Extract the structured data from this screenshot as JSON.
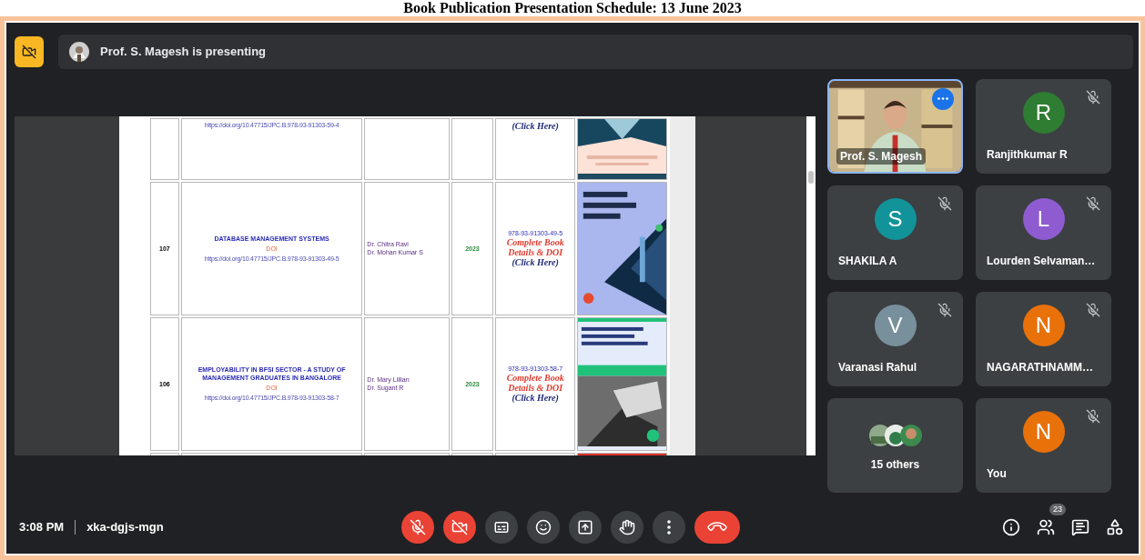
{
  "document_title": "Book Publication Presentation Schedule: 13 June 2023",
  "top_bar": {
    "presenting_label": "Prof. S. Magesh is presenting"
  },
  "table": {
    "rows": [
      {
        "number": "",
        "title": "",
        "doi_label": "",
        "url": "https://doi.org/10.47715/JPC.B.978-93-91303-59-4",
        "authors": [],
        "year": "",
        "isbn": "",
        "details_link": "",
        "click_here": "(Click Here)"
      },
      {
        "number": "107",
        "title": "DATABASE MANAGEMENT SYSTEMS",
        "doi_label": "DOI",
        "url": "https://doi.org/10.47715/JPC.B.978-93-91303-49-5",
        "authors": [
          "Dr. Chitra Ravi",
          "Dr. Mohan Kumar S"
        ],
        "year": "2023",
        "isbn": "978-93-91303-49-5",
        "details_link": "Complete Book Details & DOI",
        "click_here": "(Click Here)"
      },
      {
        "number": "106",
        "title": "EMPLOYABILITY IN BFSI SECTOR - A STUDY OF MANAGEMENT GRADUATES IN BANGALORE",
        "doi_label": "DOI",
        "url": "https://doi.org/10.47715/JPC.B.978-93-91303-58-7",
        "authors": [
          "Dr. Mary Lillian",
          "Dr. Sugant R"
        ],
        "year": "2023",
        "isbn": "978-93-91303-58-7",
        "details_link": "Complete Book Details & DOI",
        "click_here": "(Click Here)"
      }
    ]
  },
  "participants": [
    {
      "kind": "video",
      "name": "Prof. S. Magesh",
      "highlighted": true,
      "muted": false
    },
    {
      "kind": "avatar",
      "letter": "R",
      "color": "#2e7d32",
      "name": "Ranjithkumar R",
      "muted": true
    },
    {
      "kind": "avatar",
      "letter": "S",
      "color": "#12939a",
      "name": "SHAKILA A",
      "muted": true
    },
    {
      "kind": "avatar",
      "letter": "L",
      "color": "#8e5bd0",
      "name": "Lourden Selvaman…",
      "muted": true
    },
    {
      "kind": "avatar",
      "letter": "V",
      "color": "#78909c",
      "name": "Varanasi Rahul",
      "muted": true
    },
    {
      "kind": "avatar",
      "letter": "N",
      "color": "#e8710a",
      "name": "NAGARATHNAMM…",
      "muted": true
    },
    {
      "kind": "others",
      "name": "15 others",
      "muted": false
    },
    {
      "kind": "avatar",
      "letter": "N",
      "color": "#e8710a",
      "name": "You",
      "muted": true
    }
  ],
  "bottom_bar": {
    "time": "3:08 PM",
    "meeting_code": "xka-dgjs-mgn",
    "controls": [
      {
        "kind": "mic",
        "on": false
      },
      {
        "kind": "camera",
        "on": false
      },
      {
        "kind": "captions",
        "on": false
      },
      {
        "kind": "emoji",
        "on": false
      },
      {
        "kind": "present",
        "on": false
      },
      {
        "kind": "hand",
        "on": false
      },
      {
        "kind": "more"
      },
      {
        "kind": "end"
      }
    ],
    "side_buttons": [
      {
        "kind": "info"
      },
      {
        "kind": "people",
        "badge": "23"
      },
      {
        "kind": "chat"
      },
      {
        "kind": "activities"
      }
    ]
  }
}
